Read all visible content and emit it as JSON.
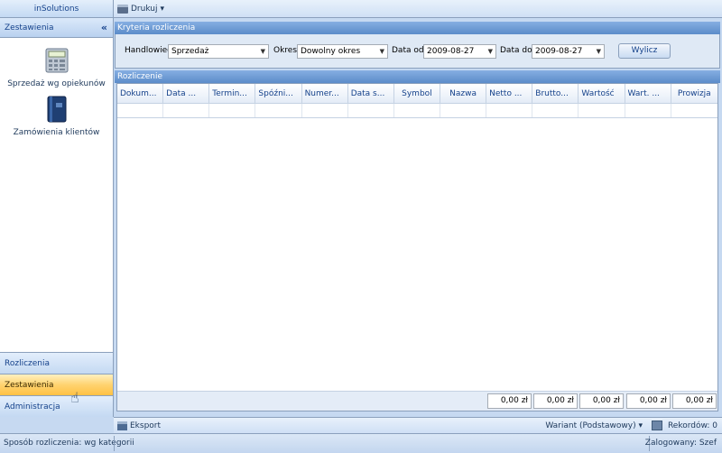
{
  "app": {
    "title": "inSolutions"
  },
  "nav": {
    "section_title": "Zestawienia",
    "collapse_glyph": "«",
    "items": [
      {
        "label": "Sprzedaż wg opiekunów",
        "icon": "calculator-icon"
      },
      {
        "label": "Zamówienia klientów",
        "icon": "book-icon"
      }
    ],
    "groups": [
      {
        "label": "Rozliczenia",
        "active": false
      },
      {
        "label": "Zestawienia",
        "active": true
      },
      {
        "label": "Administracja",
        "active": false
      }
    ]
  },
  "toolbar": {
    "print_label": "Drukuj",
    "print_arrow": "▾"
  },
  "criteria": {
    "header": "Kryteria rozliczenia",
    "salesperson_label": "Handlowiec",
    "salesperson_value": "Sprzedaż",
    "period_label": "Okres",
    "period_value": "Dowolny okres",
    "date_from_label": "Data od",
    "date_from_value": "2009-08-27",
    "date_to_label": "Data do",
    "date_to_value": "2009-08-27",
    "calculate_label": "Wylicz"
  },
  "grid": {
    "header": "Rozliczenie",
    "columns": [
      "Dokum...",
      "Data ...",
      "Termin...",
      "Spóźni...",
      "Numer...",
      "Data s...",
      "Symbol",
      "Nazwa",
      "Netto ...",
      "Brutto...",
      "Wartość",
      "Wart. ...",
      "Prowizja"
    ],
    "totals": [
      "0,00 zł",
      "0,00 zł",
      "0,00 zł",
      "0,00 zł",
      "0,00 zł"
    ]
  },
  "actions": {
    "export_label": "Eksport",
    "variant_label": "Wariant (Podstawowy) ▾",
    "records_label": "Rekordów: 0"
  },
  "status": {
    "left": "Sposób rozliczenia: wg kategorii",
    "right": "Zalogowany: Szef"
  }
}
